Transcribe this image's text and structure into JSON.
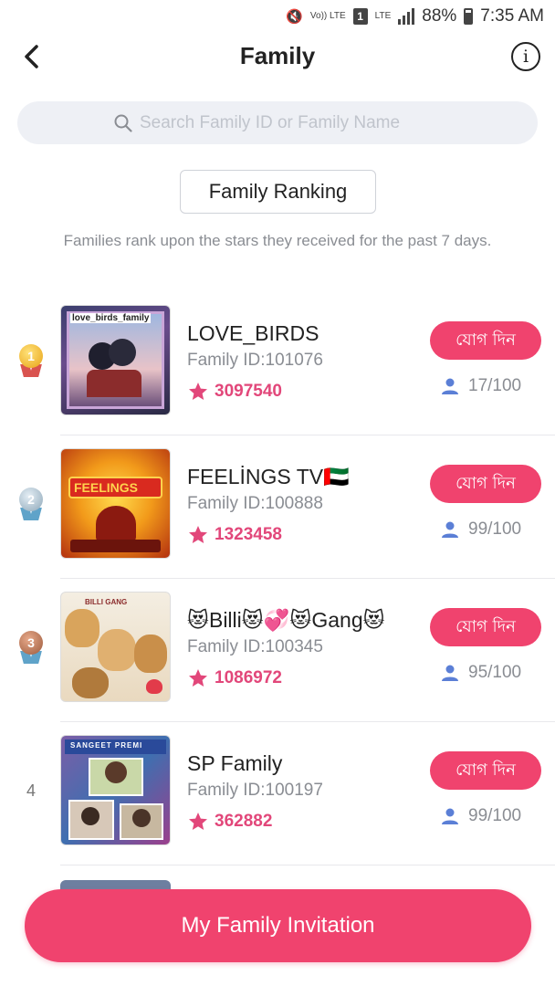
{
  "status_bar": {
    "volte": "Vo)) LTE",
    "sim": "1",
    "lte": "LTE",
    "battery": "88%",
    "time": "7:35 AM"
  },
  "header": {
    "title": "Family"
  },
  "search": {
    "placeholder": "Search Family ID or Family Name",
    "value": ""
  },
  "ranking_button": "Family Ranking",
  "description": "Families rank upon the stars they received for the past 7 days.",
  "colors": {
    "accent": "#f0436e",
    "star": "#e2477a",
    "member_icon": "#5b7fd6"
  },
  "families": [
    {
      "rank": "1",
      "medal": "gold",
      "name": "LOVE_BIRDS",
      "id": "Family ID:101076",
      "stars": "3097540",
      "join": "যোগ দিন",
      "members": "17/100",
      "thumb_text": "love_birds_family"
    },
    {
      "rank": "2",
      "medal": "silver",
      "name": "FEELİNGS TV🇦🇪",
      "id": "Family ID:100888",
      "stars": "1323458",
      "join": "যোগ দিন",
      "members": "99/100",
      "thumb_text": "FEELINGS"
    },
    {
      "rank": "3",
      "medal": "bronze",
      "name": "😻Billi😻💞😻Gang😻",
      "id": "Family ID:100345",
      "stars": "1086972",
      "join": "যোগ দিন",
      "members": "95/100",
      "thumb_text": "BILLI GANG"
    },
    {
      "rank": "4",
      "medal": "none",
      "name": "SP Family",
      "id": "Family ID:100197",
      "stars": "362882",
      "join": "যোগ দিন",
      "members": "99/100",
      "thumb_text": "SANGEET PREMI"
    }
  ],
  "invite_button": "My Family Invitation"
}
